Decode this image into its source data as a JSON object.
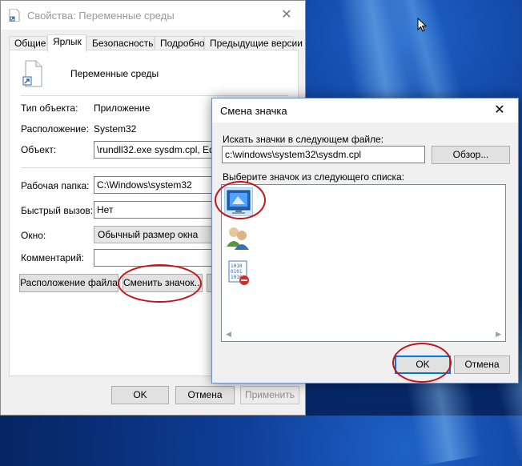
{
  "properties_window": {
    "title": "Свойства: Переменные среды",
    "close_glyph": "✕",
    "tabs": [
      "Общие",
      "Ярлык",
      "Безопасность",
      "Подробно",
      "Предыдущие версии"
    ],
    "active_tab": "Ярлык",
    "shortcut_name": "Переменные среды",
    "target_type_label": "Тип объекта:",
    "target_type_value": "Приложение",
    "location_label": "Расположение:",
    "location_value": "System32",
    "target_label": "Объект:",
    "target_value": "\\rundll32.exe sysdm.cpl, EditEnvironment",
    "start_in_label": "Рабочая папка:",
    "start_in_value": "C:\\Windows\\system32",
    "hotkey_label": "Быстрый вызов:",
    "hotkey_value": "Нет",
    "run_label": "Окно:",
    "run_value": "Обычный размер окна",
    "comment_label": "Комментарий:",
    "comment_value": "",
    "open_location_button": "Расположение файла",
    "change_icon_button": "Сменить значок...",
    "advanced_button": "Д",
    "ok_button": "OK",
    "cancel_button": "Отмена",
    "apply_button": "Применить"
  },
  "change_icon_dialog": {
    "title": "Смена значка",
    "close_glyph": "✕",
    "search_label": "Искать значки в следующем файле:",
    "file_path": "c:\\windows\\system32\\sysdm.cpl",
    "browse_button": "Обзор...",
    "list_label": "Выберите значок из следующего списка:",
    "icons": [
      "system-computer-icon",
      "users-icon",
      "binary-code-icon"
    ],
    "selected_icon": "system-computer-icon",
    "ok_button": "OK",
    "cancel_button": "Отмена"
  },
  "colors": {
    "accent": "#0078d7",
    "highlight_ring": "#c4151b",
    "desktop": "#0b3e96"
  }
}
